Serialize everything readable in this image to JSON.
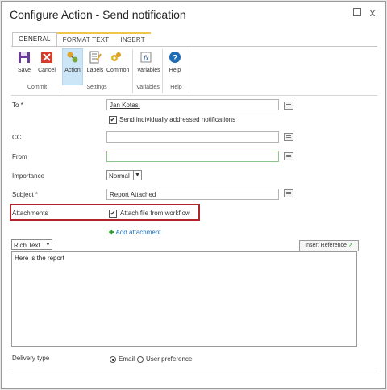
{
  "dialog": {
    "title": "Configure Action - Send notification",
    "close_glyph": "x"
  },
  "ribbon": {
    "tabs": [
      {
        "label": "GENERAL"
      },
      {
        "label": "FORMAT TEXT"
      },
      {
        "label": "INSERT"
      }
    ],
    "active_tab": "GENERAL",
    "buttons": [
      {
        "label": "Save",
        "icon": "save-icon"
      },
      {
        "label": "Cancel",
        "icon": "cancel-icon"
      },
      {
        "label": "Action",
        "icon": "action-icon"
      },
      {
        "label": "Labels",
        "icon": "labels-icon"
      },
      {
        "label": "Common",
        "icon": "common-icon"
      },
      {
        "label": "Variables",
        "icon": "variables-icon"
      },
      {
        "label": "Help",
        "icon": "help-icon"
      }
    ],
    "groups": [
      {
        "label": "Commit"
      },
      {
        "label": "Settings"
      },
      {
        "label": "Variables"
      },
      {
        "label": "Help"
      }
    ]
  },
  "form": {
    "to": {
      "label": "To *",
      "value": "Jan Kotas;"
    },
    "send_individually": {
      "label": "Send individually addressed notifications",
      "checked": true
    },
    "cc": {
      "label": "CC",
      "value": ""
    },
    "from": {
      "label": "From",
      "value": ""
    },
    "importance": {
      "label": "Importance",
      "value": "Normal"
    },
    "subject": {
      "label": "Subject *",
      "value": "Report Attached"
    },
    "attachments": {
      "label": "Attachments",
      "checkbox_label": "Attach file from workflow",
      "checked": true
    },
    "add_attachment": "Add attachment",
    "format": {
      "value": "Rich Text"
    },
    "insert_reference": "Insert Reference",
    "body": "Here is the report",
    "delivery_type": {
      "label": "Delivery type",
      "options": [
        "Email",
        "User preference"
      ],
      "selected": "Email"
    }
  },
  "colors": {
    "highlight": "#b0242a",
    "link": "#1f6db3",
    "selected_button": "#cde6f7"
  }
}
